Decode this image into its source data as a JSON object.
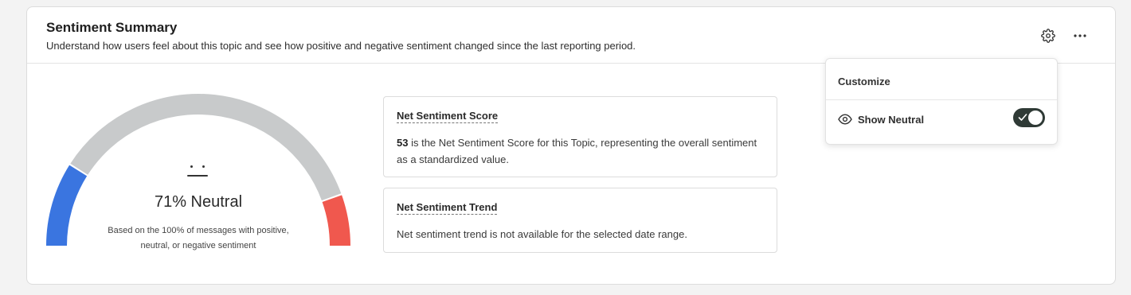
{
  "header": {
    "title": "Sentiment Summary",
    "subtitle": "Understand how users feel about this topic and see how positive and negative sentiment changed since the last reporting period."
  },
  "gauge": {
    "value_label": "71% Neutral",
    "note": "Based on the 100% of messages with positive, neutral, or negative sentiment",
    "segments": [
      {
        "name": "positive",
        "fraction": 0.18,
        "color": "#3a75e0"
      },
      {
        "name": "neutral",
        "fraction": 0.71,
        "color": "#c8cacb"
      },
      {
        "name": "negative",
        "fraction": 0.11,
        "color": "#f0584e"
      }
    ]
  },
  "net_score": {
    "title": "Net Sentiment Score",
    "value": "53",
    "text": " is the Net Sentiment Score for this Topic, representing the overall sentiment as a standardized value."
  },
  "net_trend": {
    "title": "Net Sentiment Trend",
    "text": "Net sentiment trend is not available for the selected date range."
  },
  "customize": {
    "title": "Customize",
    "option_label": "Show Neutral",
    "option_checked": true
  },
  "icons": {
    "settings": "gear-icon",
    "more": "more-horizontal-icon",
    "visibility": "eye-icon",
    "check": "check-icon"
  },
  "colors": {
    "positive": "#3a75e0",
    "neutral": "#c8cacb",
    "negative": "#f0584e",
    "toggle_on": "#2f3a36"
  }
}
